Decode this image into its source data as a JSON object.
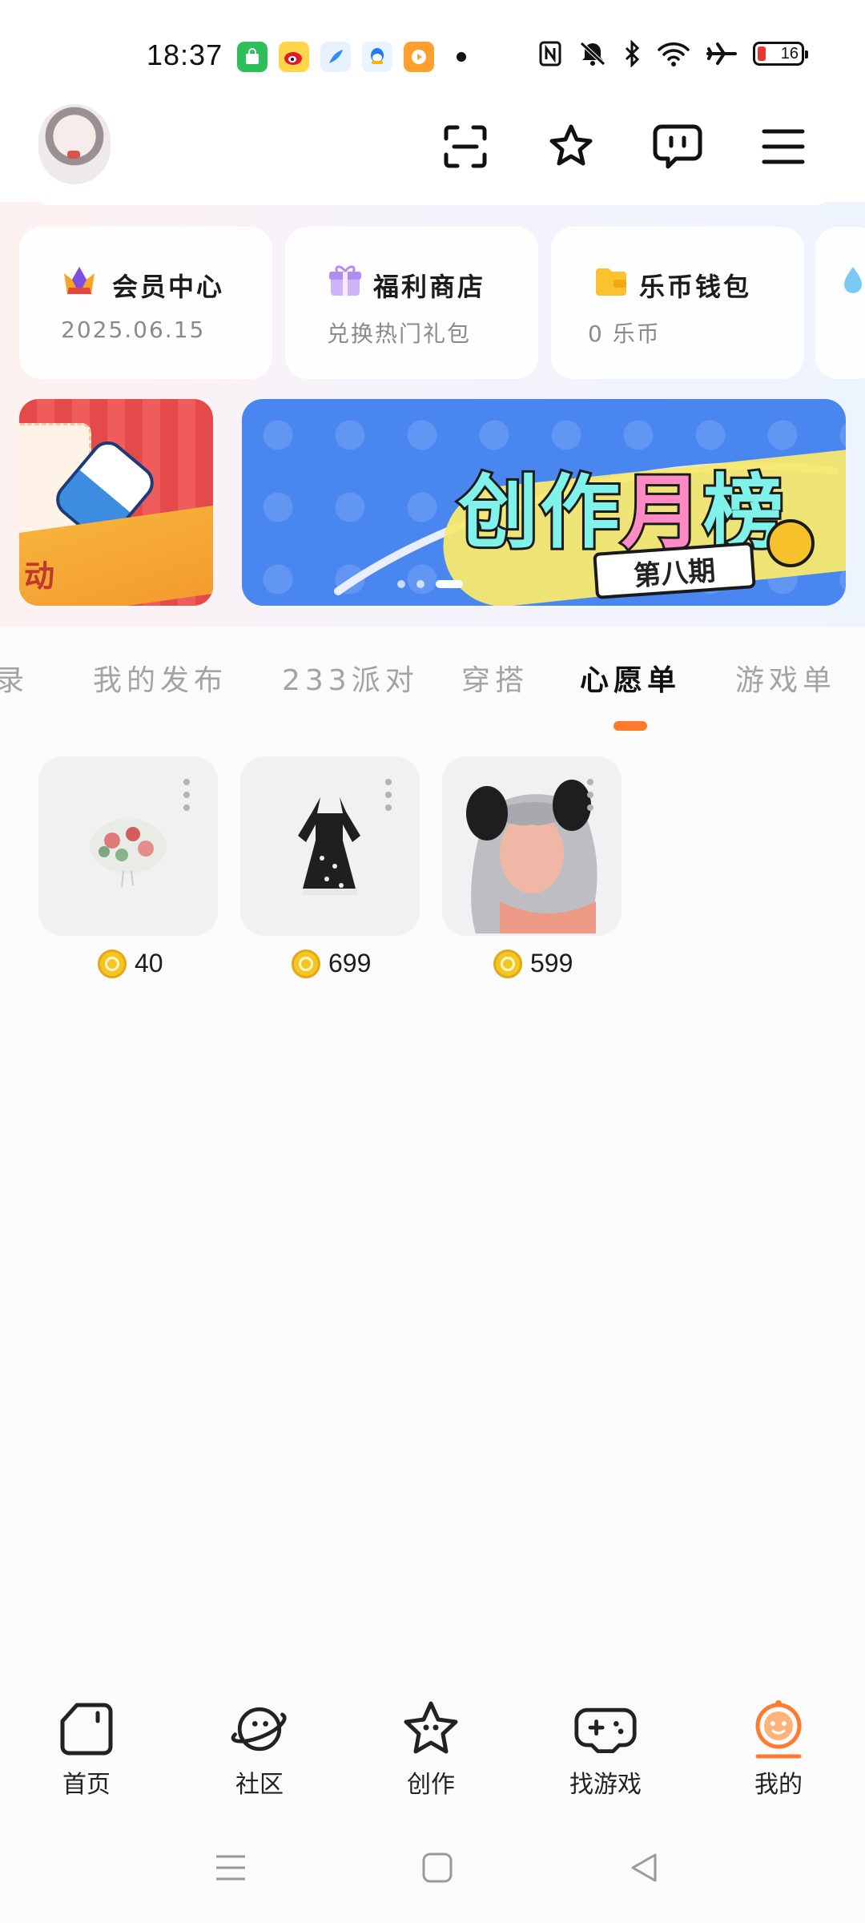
{
  "status_bar": {
    "time": "18:37",
    "notification_icons": [
      "app-store-icon",
      "weibo-icon",
      "feather-icon",
      "qq-icon",
      "video-app-icon"
    ],
    "battery_level": "16"
  },
  "header": {
    "icons": [
      "scan-icon",
      "star-icon",
      "message-icon",
      "menu-icon"
    ]
  },
  "shortcuts": [
    {
      "title": "会员中心",
      "subtitle": "2025.06.15",
      "icon": "crown-icon"
    },
    {
      "title": "福利商店",
      "subtitle": "兑换热门礼包",
      "icon": "gift-icon"
    },
    {
      "title": "乐币钱包",
      "subtitle": "0 乐币",
      "icon": "wallet-icon"
    }
  ],
  "banner": {
    "left_label": "动",
    "main_title_a": "创作",
    "main_title_b": "月",
    "main_title_c": "榜",
    "issue": "第八期"
  },
  "tabs": {
    "items": [
      "录",
      "我的发布",
      "233派对",
      "穿搭",
      "心愿单",
      "游戏单"
    ],
    "active_index": 4
  },
  "wishlist": {
    "items": [
      {
        "price": "40",
        "image": "floral-hat"
      },
      {
        "price": "699",
        "image": "black-dress"
      },
      {
        "price": "599",
        "image": "silver-hair-panda-ears"
      }
    ]
  },
  "bottom_nav": {
    "items": [
      {
        "label": "首页",
        "icon": "home-icon"
      },
      {
        "label": "社区",
        "icon": "planet-face-icon"
      },
      {
        "label": "创作",
        "icon": "star-face-icon"
      },
      {
        "label": "找游戏",
        "icon": "gamepad-icon"
      },
      {
        "label": "我的",
        "icon": "profile-face-icon"
      }
    ],
    "active_index": 4,
    "accent": "#ff7a2e"
  }
}
